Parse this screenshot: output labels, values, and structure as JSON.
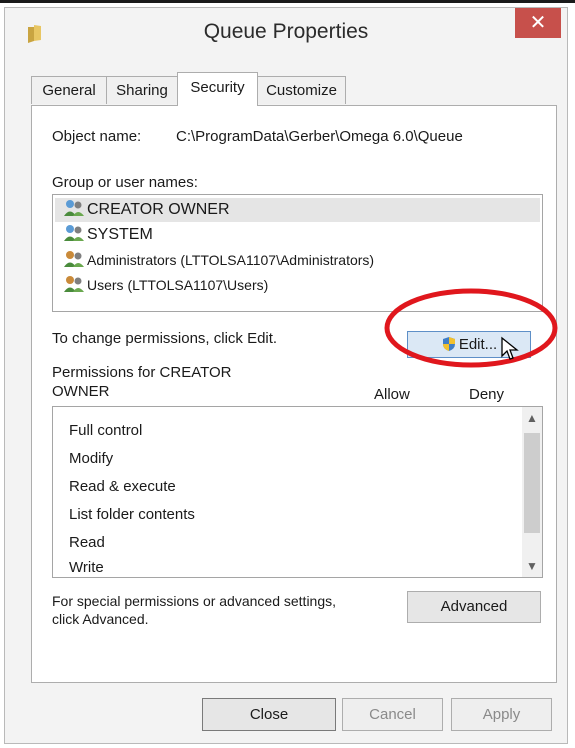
{
  "window": {
    "title": "Queue Properties",
    "close_glyph": "✕"
  },
  "tabs": [
    {
      "label": "General"
    },
    {
      "label": "Sharing"
    },
    {
      "label": "Security"
    },
    {
      "label": "Customize"
    }
  ],
  "security": {
    "object_name_label": "Object name:",
    "object_name_value": "C:\\ProgramData\\Gerber\\Omega 6.0\\Queue",
    "group_label": "Group or user names:",
    "groups": [
      {
        "name": "CREATOR OWNER"
      },
      {
        "name": "SYSTEM"
      },
      {
        "name": "Administrators (LTTOLSA1107\\Administrators)"
      },
      {
        "name": "Users (LTTOLSA1107\\Users)"
      }
    ],
    "change_hint": "To change permissions, click Edit.",
    "edit_label": "Edit...",
    "permissions_for_line1": "Permissions for CREATOR",
    "permissions_for_line2": "OWNER",
    "allow_header": "Allow",
    "deny_header": "Deny",
    "permissions": [
      {
        "name": "Full control"
      },
      {
        "name": "Modify"
      },
      {
        "name": "Read & execute"
      },
      {
        "name": "List folder contents"
      },
      {
        "name": "Read"
      },
      {
        "name": "Write"
      }
    ],
    "special_line1": "For special permissions or advanced settings,",
    "special_line2": "click Advanced.",
    "advanced_label": "Advanced"
  },
  "footer": {
    "close_label": "Close",
    "cancel_label": "Cancel",
    "apply_label": "Apply"
  },
  "colors": {
    "close_button_bg": "#c7504b",
    "annotation_ellipse": "#e0171d",
    "selected_item_bg": "#e5e5e5"
  }
}
